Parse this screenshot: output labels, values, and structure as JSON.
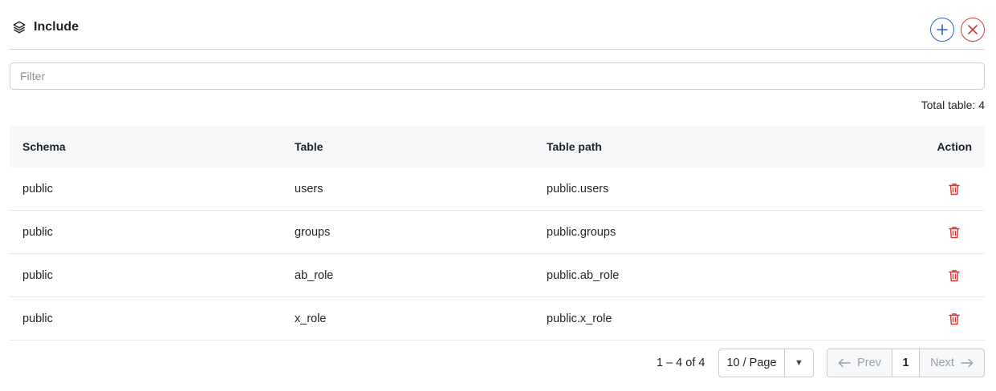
{
  "header": {
    "title": "Include",
    "title_icon": "layers-icon",
    "add_icon": "plus-icon",
    "close_icon": "close-icon"
  },
  "filter": {
    "placeholder": "Filter",
    "value": ""
  },
  "summary": {
    "total_label": "Total table: 4"
  },
  "table": {
    "headers": {
      "schema": "Schema",
      "table": "Table",
      "path": "Table path",
      "action": "Action"
    },
    "rows": [
      {
        "schema": "public",
        "table": "users",
        "path": "public.users"
      },
      {
        "schema": "public",
        "table": "groups",
        "path": "public.groups"
      },
      {
        "schema": "public",
        "table": "ab_role",
        "path": "public.ab_role"
      },
      {
        "schema": "public",
        "table": "x_role",
        "path": "public.x_role"
      }
    ],
    "action_icon": "trash-icon"
  },
  "pagination": {
    "range": "1 – 4 of 4",
    "page_size": "10 / Page",
    "prev": "Prev",
    "current_page": "1",
    "next": "Next"
  },
  "colors": {
    "add": "#2f5fd0",
    "close": "#d23a3a",
    "trash": "#e03131"
  }
}
